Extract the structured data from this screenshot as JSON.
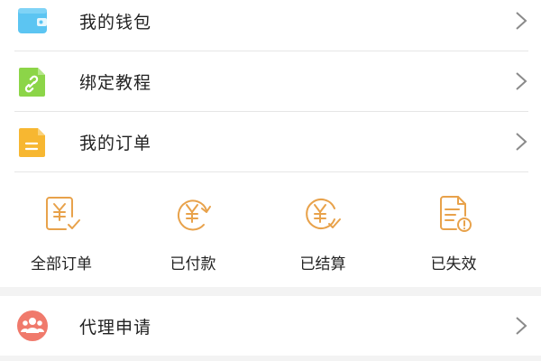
{
  "menu": {
    "wallet": {
      "label": "我的钱包",
      "icon": "wallet-icon",
      "color": "#5cc5f2"
    },
    "binding": {
      "label": "绑定教程",
      "icon": "link-document-icon",
      "color": "#8cd548"
    },
    "orders": {
      "label": "我的订单",
      "icon": "document-icon",
      "color": "#f7b731"
    },
    "agent": {
      "label": "代理申请",
      "icon": "group-icon",
      "color": "#f07a6c"
    }
  },
  "order_status": {
    "items": [
      {
        "label": "全部订单",
        "icon": "yen-receipt-check-icon"
      },
      {
        "label": "已付款",
        "icon": "yen-circle-arrow-icon"
      },
      {
        "label": "已结算",
        "icon": "yen-circle-check-icon"
      },
      {
        "label": "已失效",
        "icon": "document-warning-icon"
      }
    ],
    "accent_color": "#e8a24b"
  },
  "colors": {
    "background": "#f3f3f3",
    "card": "#ffffff",
    "text": "#222222",
    "chevron": "#8a8a8a",
    "divider": "#e6e6e6"
  }
}
